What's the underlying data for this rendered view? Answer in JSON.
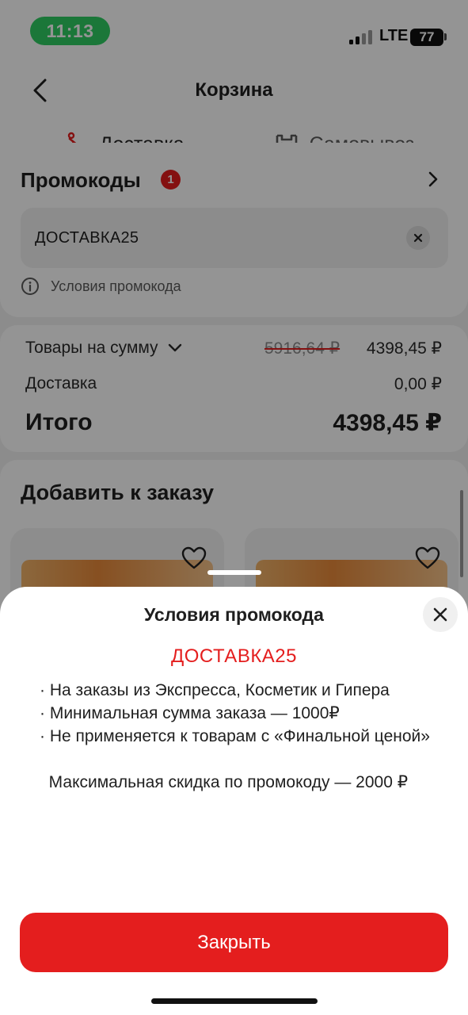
{
  "status_bar": {
    "time": "11:13",
    "network": "LTE",
    "battery": "77"
  },
  "header": {
    "title": "Корзина",
    "back_icon": "chevron-left-icon"
  },
  "tabs": [
    {
      "label": "Доставка",
      "icon": "courier-bike-icon",
      "active": true
    },
    {
      "label": "Самовывоз",
      "icon": "store-m-icon",
      "active": false
    }
  ],
  "promo": {
    "title": "Промокоды",
    "badge": "1",
    "code": "ДОСТАВКА25",
    "terms_link": "Условия промокода"
  },
  "summary": {
    "goods_label": "Товары на сумму",
    "goods_old_price": "5916,64 ₽",
    "goods_price": "4398,45 ₽",
    "delivery_label": "Доставка",
    "delivery_price": "0,00 ₽",
    "total_label": "Итого",
    "total_price": "4398,45 ₽"
  },
  "add_to_order": {
    "title": "Добавить к заказу"
  },
  "sheet": {
    "title": "Условия промокода",
    "code": "ДОСТАВКА25",
    "terms": [
      "· На заказы из Экспресса, Косметик и Гипера",
      "· Минимальная сумма заказа — 1000₽",
      "· Не применяется к товарам с «Финальной ценой»"
    ],
    "max_discount": "  Максимальная скидка по промокоду — 2000 ₽",
    "close_label": "Закрыть"
  },
  "colors": {
    "accent": "#e41e1e",
    "time_pill": "#2fce63"
  }
}
